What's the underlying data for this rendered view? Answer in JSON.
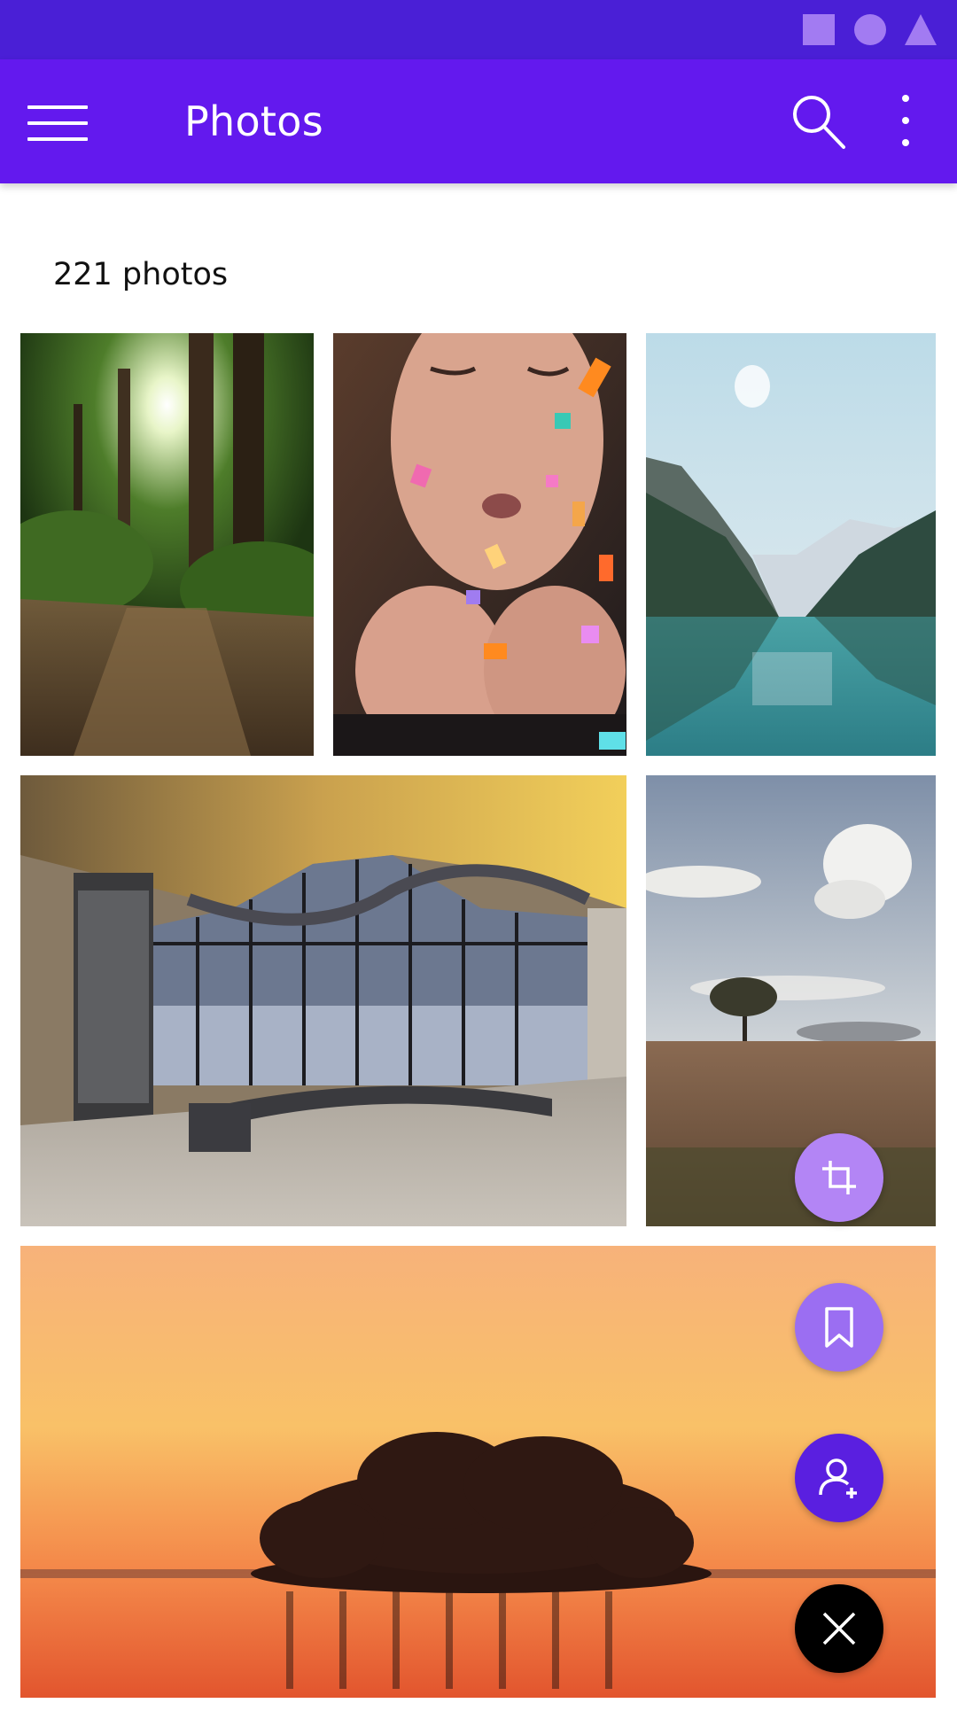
{
  "app_bar": {
    "title": "Photos",
    "icons": [
      "menu-icon",
      "search-icon",
      "more-vert-icon"
    ]
  },
  "status_bar": {
    "icons": [
      "square-icon",
      "circle-icon",
      "triangle-icon"
    ]
  },
  "gallery": {
    "count_label": "221 photos",
    "photos": [
      {
        "subject": "forest path"
      },
      {
        "subject": "woman blowing confetti"
      },
      {
        "subject": "mountain lake"
      },
      {
        "subject": "glass pavilion interior"
      },
      {
        "subject": "lone tree field"
      },
      {
        "subject": "sunset lake"
      }
    ]
  },
  "fab_menu": {
    "actions": [
      {
        "icon": "crop-icon",
        "color": "#b385f5"
      },
      {
        "icon": "bookmark-icon",
        "color": "#9b6ef2"
      },
      {
        "icon": "add-person-icon",
        "color": "#5a1fe0"
      },
      {
        "icon": "close-icon",
        "color": "#000000"
      }
    ]
  },
  "colors": {
    "status_bar": "#4a1fd6",
    "app_bar": "#6319ee",
    "status_icon": "#a27bf2"
  }
}
